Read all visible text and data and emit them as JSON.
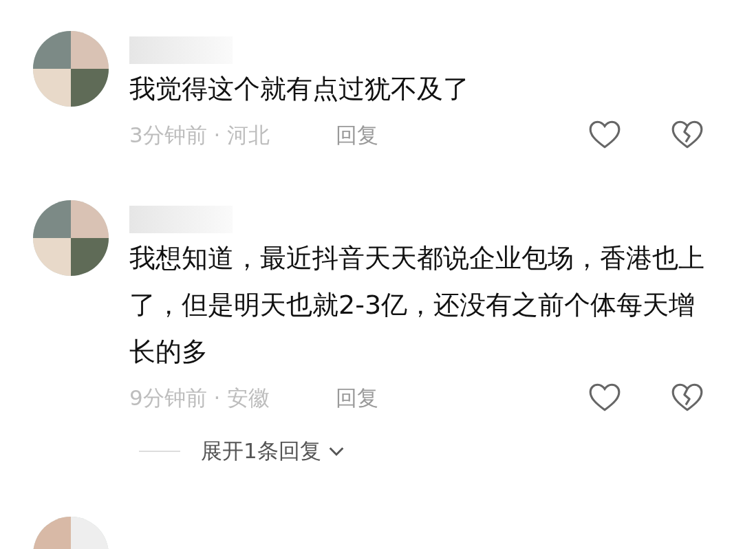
{
  "comments": [
    {
      "kind": "full",
      "text": "我觉得这个就有点过犹不及了",
      "meta": "3分钟前 · 河北",
      "reply": "回复"
    },
    {
      "kind": "full",
      "text": "我想知道，最近抖音天天都说企业包场，香港也上了，但是明天也就2-3亿，还没有之前个体每天增长的多",
      "meta": "9分钟前 · 安徽",
      "reply": "回复",
      "expand": "展开1条回复"
    },
    {
      "kind": "cut"
    }
  ]
}
